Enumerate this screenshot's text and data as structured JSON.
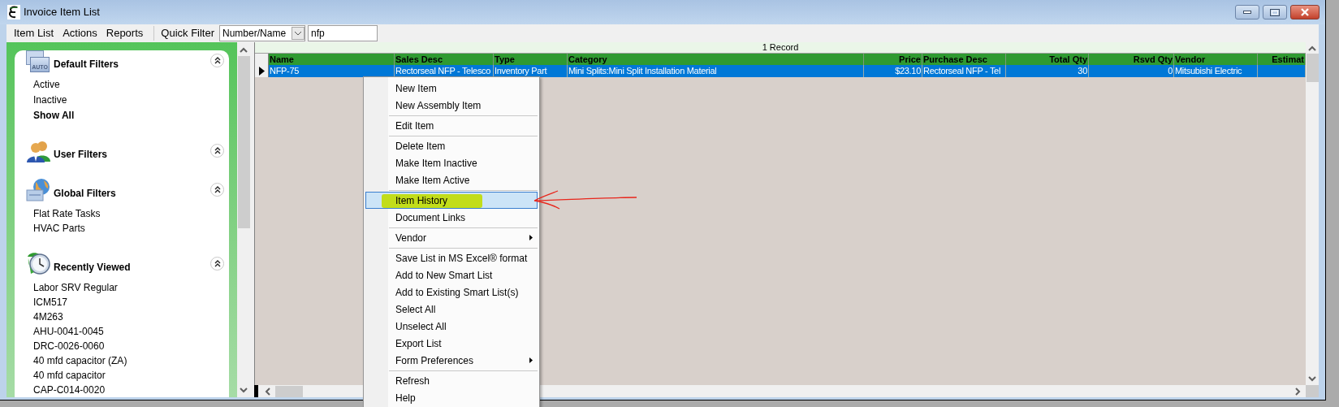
{
  "window": {
    "title": "Invoice Item List"
  },
  "menu_bar": [
    {
      "label": "Item List"
    },
    {
      "label": "Actions"
    },
    {
      "label": "Reports"
    }
  ],
  "quick_filter": {
    "label": "Quick Filter",
    "field": "Number/Name",
    "value": "nfp"
  },
  "sidebar": {
    "sections": [
      {
        "title": "Default Filters",
        "icon_text": "AUTO",
        "items": [
          {
            "label": "Active",
            "selected": false
          },
          {
            "label": "Inactive",
            "selected": false
          },
          {
            "label": "Show All",
            "selected": true
          }
        ]
      },
      {
        "title": "User Filters"
      },
      {
        "title": "Global Filters",
        "items": [
          {
            "label": "Flat Rate Tasks",
            "selected": false
          },
          {
            "label": "HVAC Parts",
            "selected": false
          }
        ]
      },
      {
        "title": "Recently Viewed",
        "items": [
          {
            "label": "Labor SRV Regular",
            "selected": false
          },
          {
            "label": "ICM517",
            "selected": false
          },
          {
            "label": "4M263",
            "selected": false
          },
          {
            "label": "AHU-0041-0045",
            "selected": false
          },
          {
            "label": "DRC-0026-0060",
            "selected": false
          },
          {
            "label": "40 mfd capacitor (ZA)",
            "selected": false
          },
          {
            "label": "40 mfd capacitor",
            "selected": false
          },
          {
            "label": "CAP-C014-0020",
            "selected": false
          }
        ]
      }
    ]
  },
  "grid": {
    "record_count": "1 Record",
    "columns": [
      {
        "label": "Name"
      },
      {
        "label": "Sales Desc"
      },
      {
        "label": "Type"
      },
      {
        "label": "Category"
      },
      {
        "label": "Price"
      },
      {
        "label": "Purchase Desc"
      },
      {
        "label": "Total Qty"
      },
      {
        "label": "Rsvd Qty"
      },
      {
        "label": "Vendor"
      },
      {
        "label": "Estimat"
      }
    ],
    "rows": [
      {
        "selected": true,
        "cells": [
          "NFP-75",
          "Rectorseal NFP - Telesco",
          "Inventory Part",
          "Mini Splits:Mini Split Installation Material",
          "$23.10",
          "Rectorseal NFP - Tel",
          "30",
          "0",
          "Mitsubishi Electric",
          ""
        ]
      }
    ]
  },
  "context_menu": {
    "items": [
      {
        "kind": "item",
        "label": "New Item",
        "submenu": false,
        "selected": false
      },
      {
        "kind": "item",
        "label": "New Assembly Item",
        "submenu": false,
        "selected": false
      },
      {
        "kind": "separator"
      },
      {
        "kind": "item",
        "label": "Edit Item",
        "submenu": false,
        "selected": false
      },
      {
        "kind": "separator"
      },
      {
        "kind": "item",
        "label": "Delete Item",
        "submenu": false,
        "selected": false
      },
      {
        "kind": "item",
        "label": "Make Item Inactive",
        "submenu": false,
        "selected": false
      },
      {
        "kind": "item",
        "label": "Make Item Active",
        "submenu": false,
        "selected": false
      },
      {
        "kind": "separator"
      },
      {
        "kind": "item",
        "label": "Item History",
        "submenu": false,
        "selected": true
      },
      {
        "kind": "item",
        "label": "Document Links",
        "submenu": false,
        "selected": false
      },
      {
        "kind": "separator"
      },
      {
        "kind": "item",
        "label": "Vendor",
        "submenu": true,
        "selected": false
      },
      {
        "kind": "separator"
      },
      {
        "kind": "item",
        "label": "Save List in MS Excel® format",
        "submenu": false,
        "selected": false
      },
      {
        "kind": "item",
        "label": "Add to New Smart List",
        "submenu": false,
        "selected": false
      },
      {
        "kind": "item",
        "label": "Add to Existing Smart List(s)",
        "submenu": false,
        "selected": false
      },
      {
        "kind": "item",
        "label": "Select All",
        "submenu": false,
        "selected": false
      },
      {
        "kind": "item",
        "label": "Unselect All",
        "submenu": false,
        "selected": false
      },
      {
        "kind": "item",
        "label": "Export List",
        "submenu": false,
        "selected": false
      },
      {
        "kind": "item",
        "label": "Form Preferences",
        "submenu": true,
        "selected": false
      },
      {
        "kind": "separator"
      },
      {
        "kind": "item",
        "label": "Refresh",
        "submenu": false,
        "selected": false
      },
      {
        "kind": "item",
        "label": "Help",
        "submenu": false,
        "selected": false
      }
    ]
  }
}
